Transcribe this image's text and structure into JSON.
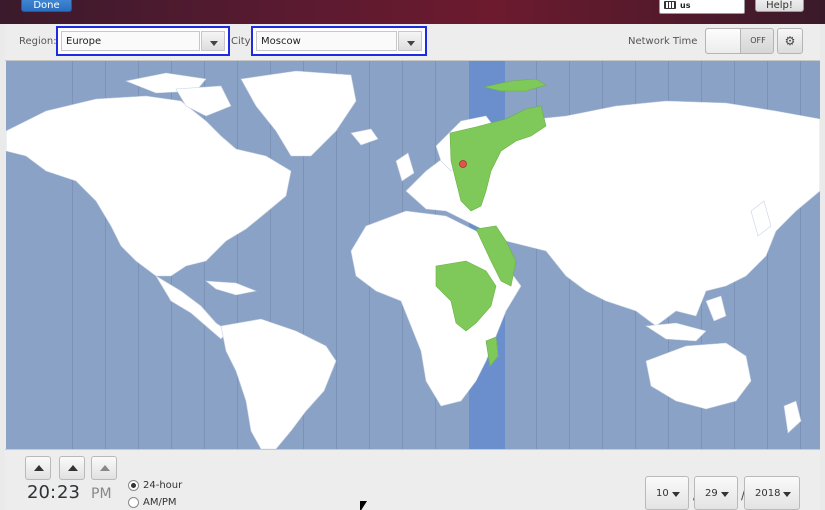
{
  "header": {
    "done_label": "Done",
    "keyboard_layout": "us",
    "help_label": "Help!"
  },
  "toolbar": {
    "region_label": "Region:",
    "region_value": "Europe",
    "city_label": "City:",
    "city_value": "Moscow",
    "network_time_label": "Network Time",
    "network_time_state": "OFF"
  },
  "map": {
    "land_color": "#ffffff",
    "ocean_color": "#8aa2c5",
    "highlight_color": "#7fc95a",
    "selected_tz_color": "#6a8fcc",
    "pin_color": "#e2534a"
  },
  "clock": {
    "hours": "20",
    "separator": ":",
    "minutes": "23",
    "period": "PM",
    "format_24h_label": "24-hour",
    "format_ampm_label": "AM/PM",
    "selected_format": "24-hour"
  },
  "date": {
    "month": "10",
    "day": "29",
    "year": "2018",
    "separator": "/"
  }
}
